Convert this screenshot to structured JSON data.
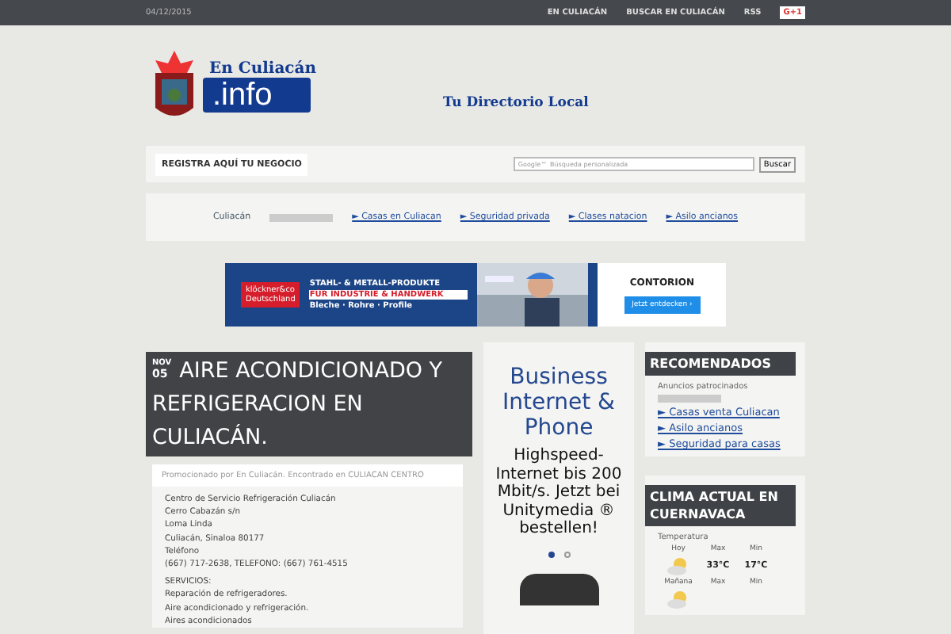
{
  "top_bar": {
    "date": "04/12/2015",
    "links": [
      "EN CULIACÁN",
      "BUSCAR EN CULIACÁN",
      "RSS"
    ],
    "gplus": "G+1"
  },
  "header": {
    "logo_top": "En Culiacán",
    "logo_bottom": ".info",
    "tagline": "Tu Directorio Local"
  },
  "register_bar": {
    "label": "REGISTRA AQUÍ TU NEGOCIO",
    "search_placeholder": "Búsqueda personalizada",
    "search_brand": "Google™",
    "search_button": "Buscar"
  },
  "links_bar": {
    "city": "Culiacán",
    "links": [
      "► Casas en Culiacan",
      "► Seguridad privada",
      "► Clases natacion",
      "► Asilo ancianos"
    ]
  },
  "banner_ad": {
    "brand": "klöckner&co",
    "brand_sub": "Deutschland",
    "line1": "STAHL- & METALL-PRODUKTE",
    "line2": "FÜR INDUSTRIE & HANDWERK",
    "line3": "Bleche · Rohre · Profile",
    "advertiser": "CONTORION",
    "cta": "Jetzt entdecken ›"
  },
  "post": {
    "month": "NOV",
    "day": "05",
    "title": "AIRE ACONDICIONADO Y REFRIGERACION EN CULIACÁN.",
    "meta": "Promocionado por En Culiacán. Encontrado en CULIACAN CENTRO",
    "address": [
      "Centro de Servicio Refrigeración Culiacán",
      "Cerro Cabazán s/n",
      "Loma Linda",
      "Culiacán, Sinaloa 80177",
      "Teléfono",
      "(667) 717-2638, TELEFONO: (667) 761-4515"
    ],
    "services": [
      "SERVICIOS:",
      "Reparación de refrigeradores.",
      "Aire acondicionado y refrigeración.",
      "Aires acondicionados"
    ]
  },
  "side_ad": {
    "title": "Business Internet & Phone",
    "body": "Highspeed-Internet bis 200 Mbit/s. Jetzt bei Unitymedia ® bestellen!",
    "dots": [
      {
        "selected": true
      },
      {
        "selected": false
      }
    ]
  },
  "recommended": {
    "title": "RECOMENDADOS",
    "sponsored": "Anuncios patrocinados",
    "links": [
      "► Casas venta Culiacan",
      "► Asilo ancianos",
      "► Seguridad para casas"
    ]
  },
  "weather": {
    "title": "CLIMA ACTUAL EN CUERNAVACA",
    "label": "Temperatura",
    "rows": [
      {
        "day": "Hoy",
        "max_label": "Max",
        "min_label": "Min",
        "max": "33°C",
        "min": "17°C"
      },
      {
        "day": "Mañana",
        "max_label": "Max",
        "min_label": "Min"
      }
    ]
  }
}
